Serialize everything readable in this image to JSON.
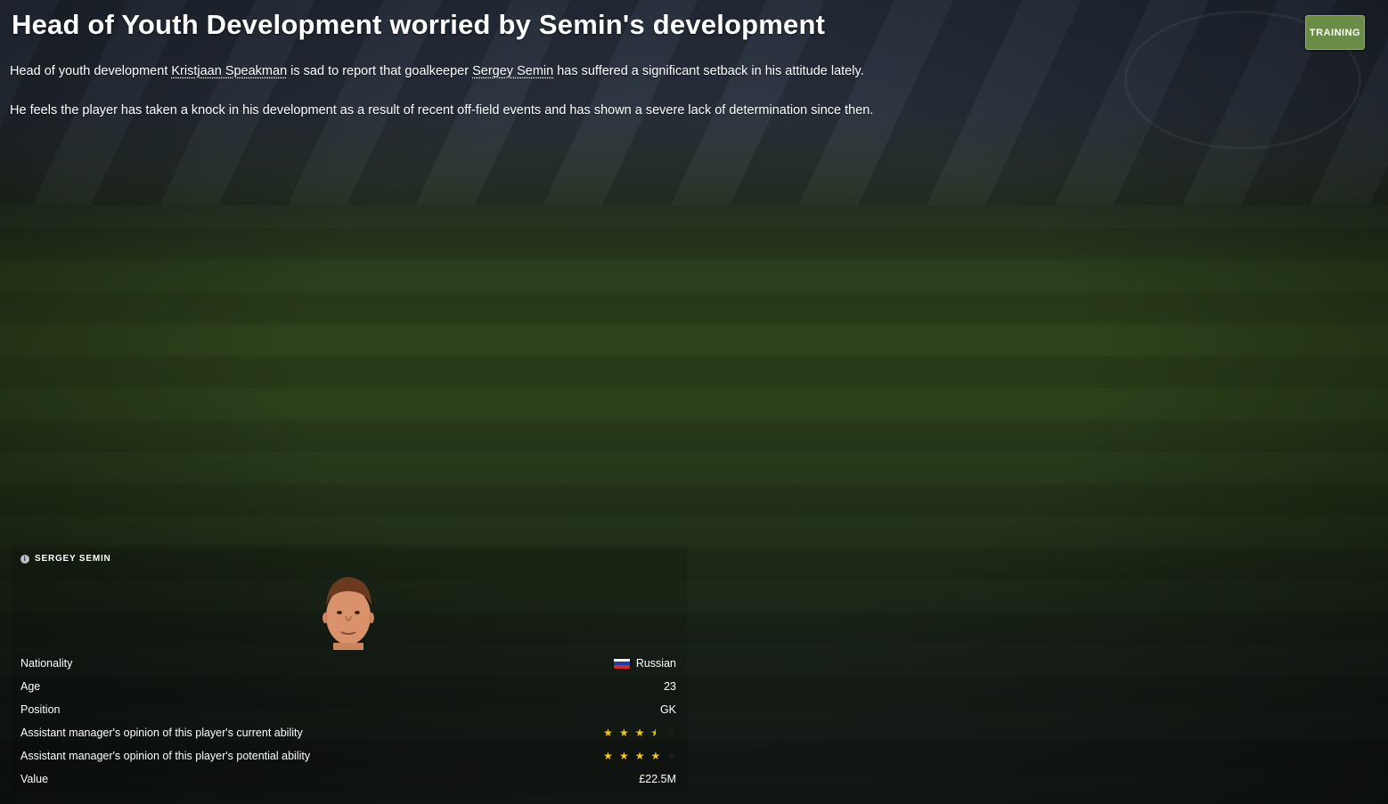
{
  "headline": "Head of Youth Development worried by Semin's development",
  "tag_button": "TRAINING",
  "paragraph1": {
    "t1": "Head of youth development ",
    "link1": "Kristjaan Speakman",
    "t2": " is sad to report that goalkeeper ",
    "link2": "Sergey Semin",
    "t3": " has suffered a significant setback in his attitude lately."
  },
  "paragraph2": "He feels the player has taken a knock in his development as a result of recent off-field events and has shown a severe lack of determination since then.",
  "player_panel": {
    "title": "SERGEY SEMIN",
    "rows": [
      {
        "label": "Nationality",
        "value": "Russian"
      },
      {
        "label": "Age",
        "value": "23"
      },
      {
        "label": "Position",
        "value": "GK"
      },
      {
        "label": "Assistant manager's opinion of this player's current ability",
        "stars": 3.5,
        "max": 5
      },
      {
        "label": "Assistant manager's opinion of this player's potential ability",
        "stars": 4,
        "max": 5
      },
      {
        "label": "Value",
        "value": "£22.5M"
      }
    ]
  },
  "colors": {
    "tag_green": "#6a8c46",
    "star_gold": "#f2c81b",
    "flag_russia": [
      "#ffffff",
      "#1c3fa8",
      "#d52b1e"
    ]
  }
}
